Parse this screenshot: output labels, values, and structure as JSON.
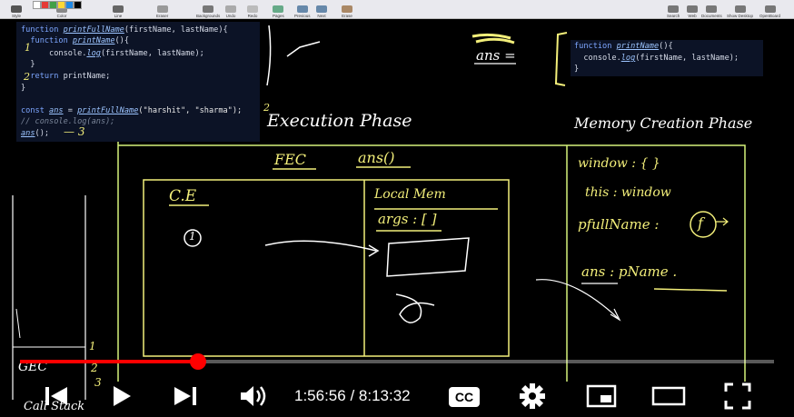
{
  "toolbar": {
    "items": [
      "Style",
      "Color",
      "Line",
      "Eraser",
      "Backgrounds",
      "Undo",
      "Redo",
      "Pages",
      "Previous",
      "Next",
      "Erase"
    ],
    "right_items": [
      "Search",
      "Web",
      "Documents",
      "Show Desktop",
      "OpenBoard"
    ],
    "swatch_colors": [
      "#ffffff",
      "#e53935",
      "#43a047",
      "#fdd835",
      "#1e88e5",
      "#000000"
    ]
  },
  "code_panel": {
    "lines": [
      {
        "parts": [
          {
            "t": "function ",
            "c": "kw"
          },
          {
            "t": "printFullName",
            "c": "fn"
          },
          {
            "t": "(firstName, lastName){",
            "c": ""
          }
        ]
      },
      {
        "parts": [
          {
            "t": "  function ",
            "c": "kw"
          },
          {
            "t": "printName",
            "c": "fn"
          },
          {
            "t": "(){",
            "c": ""
          }
        ]
      },
      {
        "parts": [
          {
            "t": "      console.",
            "c": ""
          },
          {
            "t": "log",
            "c": "fn"
          },
          {
            "t": "(firstName, lastName);",
            "c": ""
          }
        ]
      },
      {
        "parts": [
          {
            "t": "  }",
            "c": ""
          }
        ]
      },
      {
        "parts": [
          {
            "t": "  return ",
            "c": "kw"
          },
          {
            "t": "printName;",
            "c": ""
          }
        ]
      },
      {
        "parts": [
          {
            "t": "}",
            "c": ""
          }
        ]
      },
      {
        "parts": [
          {
            "t": "",
            "c": ""
          }
        ]
      },
      {
        "parts": [
          {
            "t": "const ",
            "c": "kw"
          },
          {
            "t": "ans",
            "c": "fn"
          },
          {
            "t": " = ",
            "c": ""
          },
          {
            "t": "printFullName",
            "c": "fn"
          },
          {
            "t": "(\"harshit\", \"sharma\");",
            "c": "str"
          }
        ]
      },
      {
        "parts": [
          {
            "t": "// console.log(ans);",
            "c": "cmt"
          }
        ]
      },
      {
        "parts": [
          {
            "t": "ans",
            "c": "fn"
          },
          {
            "t": "();",
            "c": ""
          }
        ]
      }
    ]
  },
  "code_panel2": {
    "lines": [
      {
        "parts": [
          {
            "t": "function ",
            "c": "kw"
          },
          {
            "t": "printName",
            "c": "fn"
          },
          {
            "t": "(){",
            "c": ""
          }
        ]
      },
      {
        "parts": [
          {
            "t": "  console.",
            "c": ""
          },
          {
            "t": "log",
            "c": "fn"
          },
          {
            "t": "(firstName, lastName);",
            "c": ""
          }
        ]
      },
      {
        "parts": [
          {
            "t": "}",
            "c": ""
          }
        ]
      }
    ]
  },
  "annotations": {
    "ans_eq": "ans  =",
    "execution_phase": "Execution  Phase",
    "memory_creation_phase": "Memory  Creation  Phase",
    "fec": "FEC",
    "ans_call": "ans()",
    "ce": "C.E",
    "local_mem": "Local  Mem",
    "args": "args : [  ]",
    "window": "window : {  }",
    "this_window": "this : window",
    "pfullname": "pfullName :",
    "f_circle": "f",
    "ans_pname": "ans : pName .",
    "gec": "GEC",
    "call_stack": "Call Stack",
    "one": "1",
    "two": "2",
    "three": "3",
    "circled_one": "1",
    "arrow_three": "— 3"
  },
  "video": {
    "progress": 0.236,
    "current_time": "1:56:56",
    "separator": " / ",
    "duration": "8:13:32",
    "cc_label": "CC",
    "colors": {
      "played": "#ff0000",
      "buffered": "rgba(255,255,255,0.35)"
    }
  }
}
